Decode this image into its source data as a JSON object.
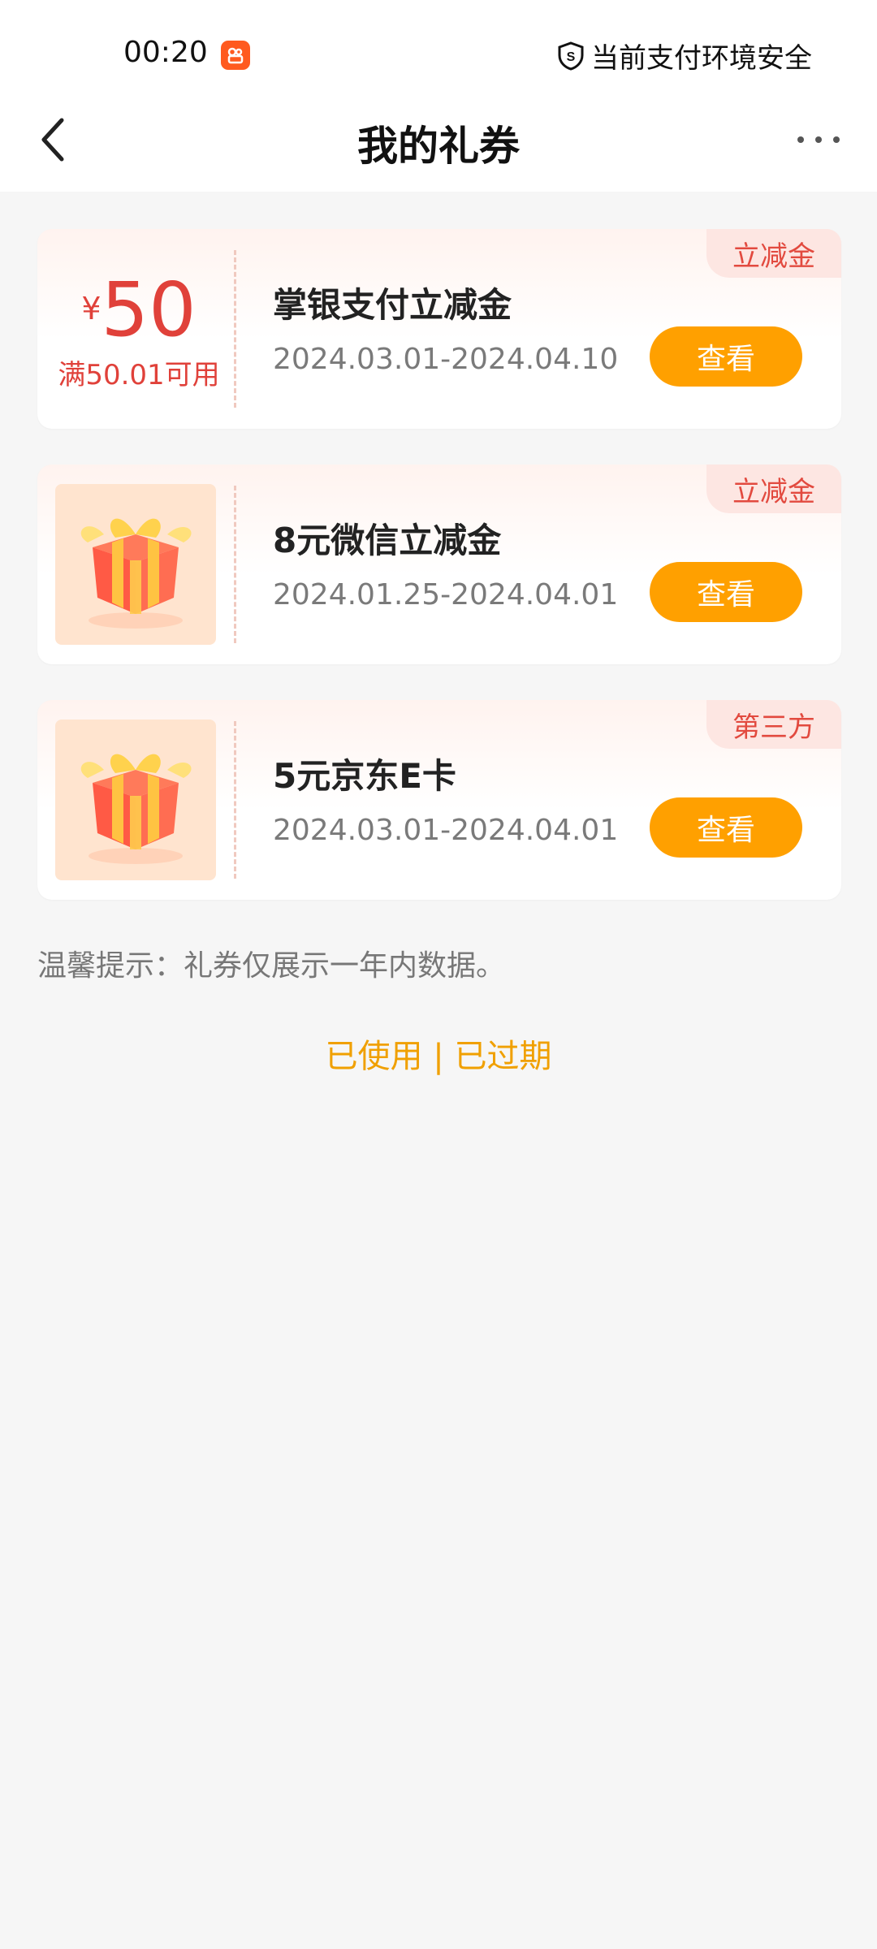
{
  "status": {
    "time": "00:20",
    "security_text": "当前支付环境安全",
    "icons": [
      "app-badge-icon",
      "shield-icon"
    ]
  },
  "header": {
    "title": "我的礼券",
    "back_icon": "chevron-left-icon",
    "more_icon": "more-dots-icon"
  },
  "coupons": [
    {
      "tag": "立减金",
      "type": "amount",
      "currency": "¥",
      "amount": "50",
      "condition": "满50.01可用",
      "name": "掌银支付立减金",
      "date_range": "2024.03.01-2024.04.10",
      "button": "查看"
    },
    {
      "tag": "立减金",
      "type": "gift",
      "icon": "gift-box-icon",
      "name": "8元微信立减金",
      "date_range": "2024.01.25-2024.04.01",
      "button": "查看"
    },
    {
      "tag": "第三方",
      "type": "gift",
      "icon": "gift-box-icon",
      "name": "5元京东E卡",
      "date_range": "2024.03.01-2024.04.01",
      "button": "查看"
    }
  ],
  "tip": "温馨提示：礼券仅展示一年内数据。",
  "links": {
    "used": "已使用",
    "separator": "|",
    "expired": "已过期"
  },
  "colors": {
    "accent_orange": "#ffa000",
    "tag_red": "#e24a3f",
    "amount_red": "#e0413a",
    "link_orange": "#f0a000"
  }
}
